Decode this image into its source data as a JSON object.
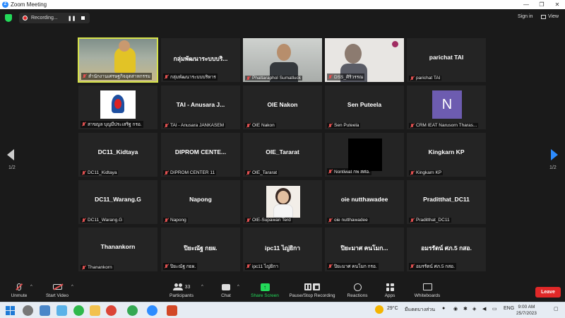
{
  "window": {
    "title": "Zoom Meeting",
    "min": "—",
    "restore": "❐",
    "close": "✕"
  },
  "topbar": {
    "recording_label": "Recording...",
    "pause_glyph": "❚❚",
    "signin": "Sign in",
    "view": "View"
  },
  "pagination": {
    "left": "1/2",
    "right": "1/2"
  },
  "tiles": [
    {
      "big": "",
      "name": "สำนักงานเศรษฐกิจอุตสาหกรรม"
    },
    {
      "big": "กลุ่มพัฒนาระบบบริ...",
      "name": "กลุ่มพัฒนาระบบบริหาร"
    },
    {
      "big": "",
      "name": "Phattaraphol Sumatluck"
    },
    {
      "big": "",
      "name": "DSS_ศิริวรรณ"
    },
    {
      "big": "parichat TAI",
      "name": "parichat TAI"
    },
    {
      "big": "",
      "name": "สาขญล บุญมีประเสริฐ กรอ."
    },
    {
      "big": "TAI - Anusara J...",
      "name": "TAI - Anusara JANKASEM"
    },
    {
      "big": "OIE Nakon",
      "name": "OIE Nakon"
    },
    {
      "big": "Sen Puteela",
      "name": "Sen Puteela"
    },
    {
      "big": "N",
      "name": "CRM IEAT Narusorn Tharas..."
    },
    {
      "big": "DC11_Kidtaya",
      "name": "DC11_Kidtaya"
    },
    {
      "big": "DIPROM CENTE...",
      "name": "DIPROM CENTER 11"
    },
    {
      "big": "OIE_Tararat",
      "name": "OIE_Tararat"
    },
    {
      "big": "",
      "name": "Nontiwat กพ สศอ."
    },
    {
      "big": "Kingkarn KP",
      "name": "Kingkarn KP"
    },
    {
      "big": "DC11_Warang.G",
      "name": "DC11_Warang.G"
    },
    {
      "big": "Napong",
      "name": "Napong"
    },
    {
      "big": "",
      "name": "OIE-Supawan Terd"
    },
    {
      "big": "oie nutthawadee",
      "name": "oie nutthawadee"
    },
    {
      "big": "Praditthat_DC11",
      "name": "Praditthat_DC11"
    },
    {
      "big": "Thanankorn",
      "name": "Thanankorn"
    },
    {
      "big": "ปิยะณัฐ กยผ.",
      "name": "ปิยะณัฐ กยผ."
    },
    {
      "big": "ipc11 ไญ่ยิกา",
      "name": "ipc11 ไญ่ยิกา"
    },
    {
      "big": "ปิยะมาศ คนโมก...",
      "name": "ปิยะมาศ คนโมก กรอ."
    },
    {
      "big": "อมรรัตน์ ศภ.5 กสอ.",
      "name": "อมรรัตน์ ศภ.5 กสอ."
    }
  ],
  "toolbar": {
    "unmute": "Unmute",
    "start_video": "Start Video",
    "participants": "Participants",
    "participants_count": "33",
    "chat": "Chat",
    "share": "Share Screen",
    "record": "Pause/Stop Recording",
    "reactions": "Reactions",
    "apps": "Apps",
    "whiteboards": "Whiteboards",
    "leave": "Leave",
    "caret": "^"
  },
  "taskbar": {
    "weather_temp": "29°C",
    "weather_desc": "มีแดดบางส่วน",
    "lang": "ENG",
    "time": "9:00 AM",
    "date": "25/7/2023"
  },
  "colors": {
    "active_speaker": "#d6e34b",
    "leave": "#e02828",
    "share": "#23d959",
    "accent": "#2d8cff"
  }
}
